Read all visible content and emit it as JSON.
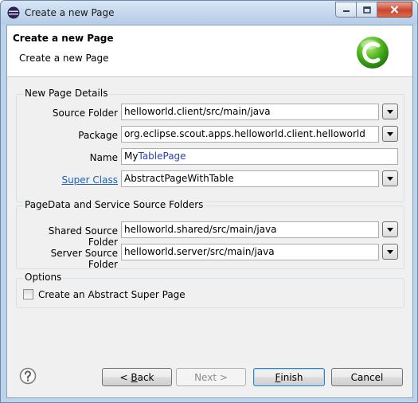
{
  "window": {
    "title": "Create a new Page"
  },
  "header": {
    "title": "Create a new Page",
    "description": "Create a new Page"
  },
  "new_page_details": {
    "title": "New Page Details",
    "source_folder": {
      "label": "Source Folder",
      "value": "helloworld.client/src/main/java"
    },
    "package": {
      "label": "Package",
      "value": "org.eclipse.scout.apps.helloworld.client.helloworld"
    },
    "name": {
      "label": "Name",
      "prefix": "My",
      "highlight": "TablePage"
    },
    "super_class": {
      "label": "Super Class",
      "value": "AbstractPageWithTable"
    }
  },
  "pagedata": {
    "title": "PageData and Service Source Folders",
    "shared_source_folder": {
      "label": "Shared Source Folder",
      "value": "helloworld.shared/src/main/java"
    },
    "server_source_folder": {
      "label": "Server Source Folder",
      "value": "helloworld.server/src/main/java"
    }
  },
  "options": {
    "title": "Options",
    "abstract_super_page": {
      "label": "Create an Abstract Super Page",
      "checked": false
    }
  },
  "buttons": {
    "back": {
      "mnemonic": "B",
      "rest": "ack",
      "prefix": "< "
    },
    "next": {
      "label": "Next >"
    },
    "finish": {
      "mnemonic": "F",
      "rest": "inish"
    },
    "cancel": {
      "label": "Cancel"
    }
  }
}
